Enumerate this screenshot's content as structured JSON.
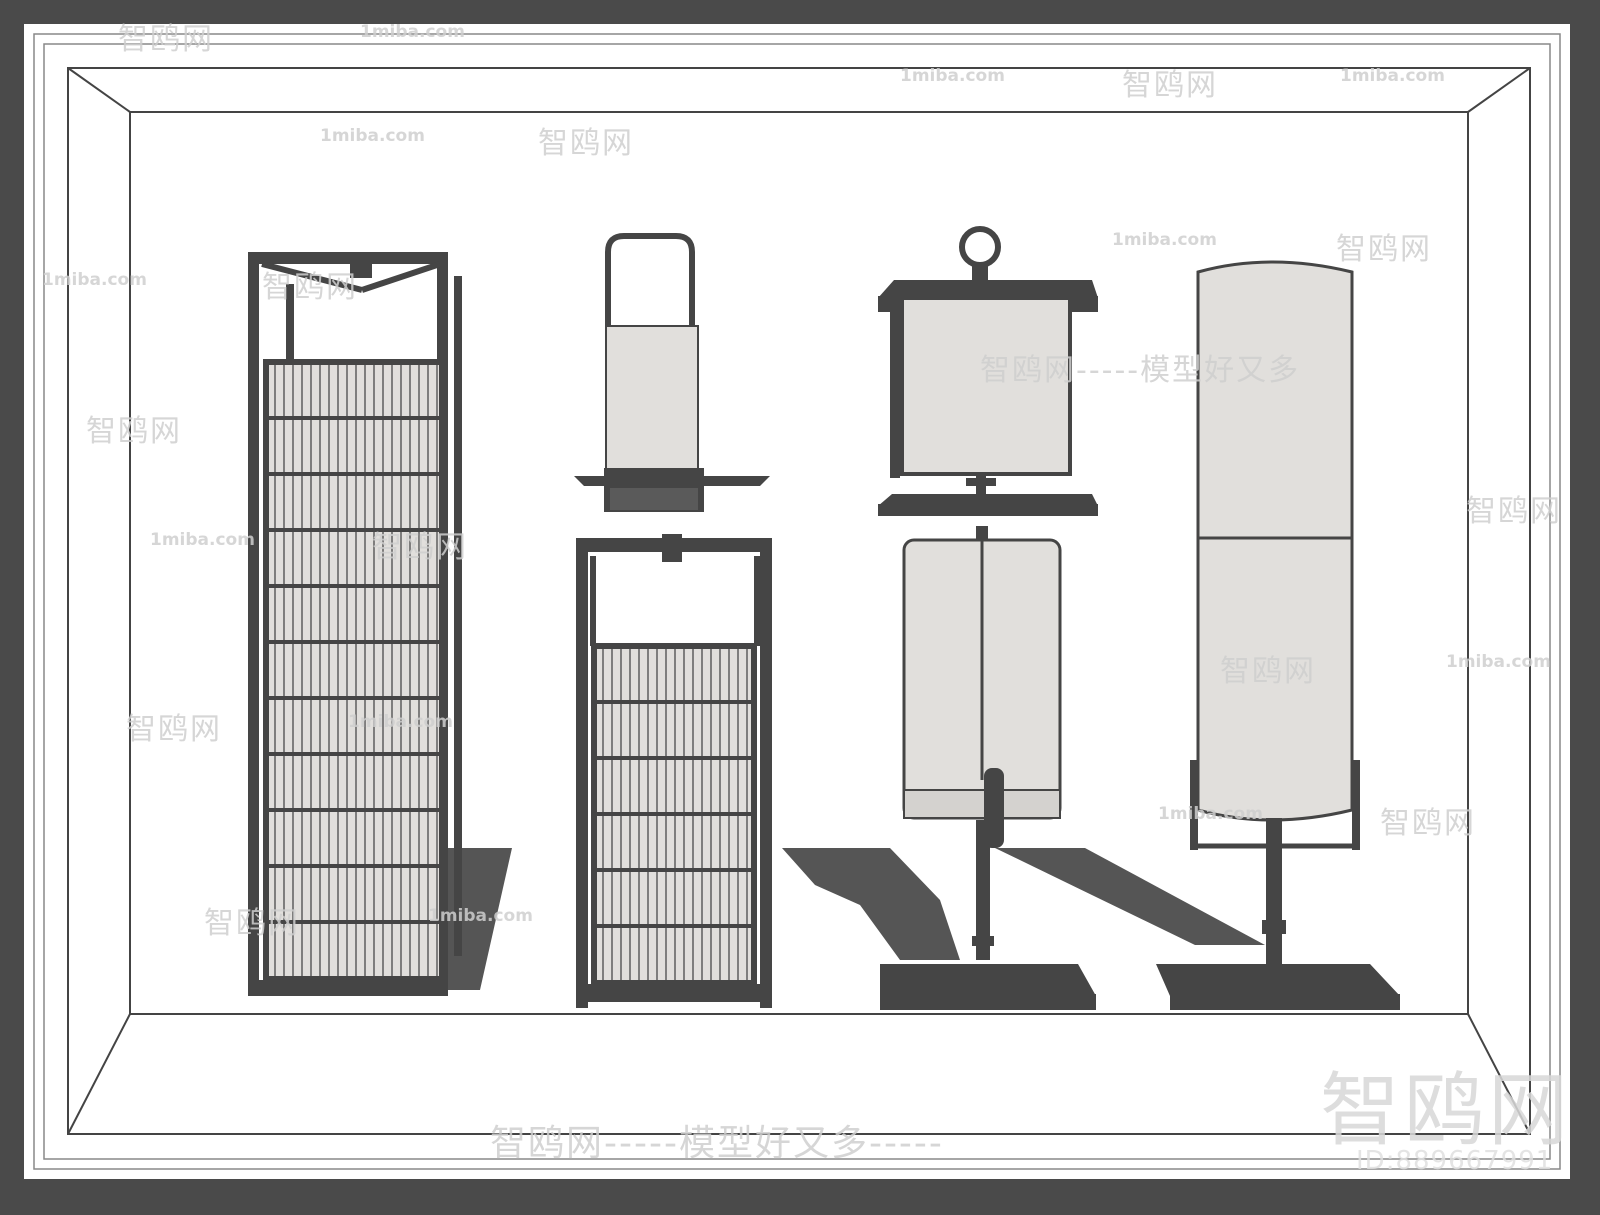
{
  "watermarks": {
    "site_url": "1miba.com",
    "brand": "智鸥网",
    "slogan": "智鸥网-----模型好又多-----",
    "mid_slogan": "智鸥网-----模型好又多",
    "big_brand": "智鸥网",
    "id_label": "ID:889667991"
  },
  "colors": {
    "frame": "#4a4a4a",
    "metal": "#454545",
    "shade": "#e1dfdc",
    "shadow": "#555555",
    "canvas": "#ffffff"
  },
  "objects": [
    "floor-lantern-grid",
    "hanging-lantern-on-stand",
    "square-and-cylinder-lamp",
    "tall-cylinder-floor-lamp"
  ]
}
